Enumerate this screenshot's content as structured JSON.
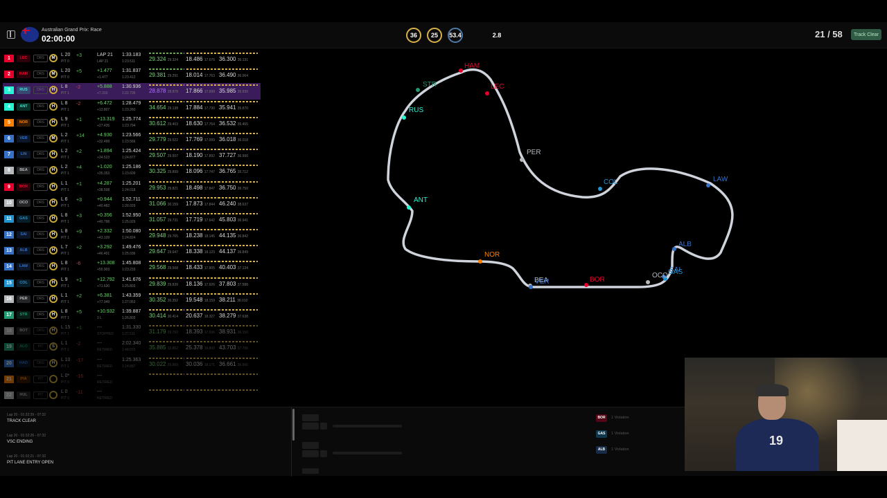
{
  "header": {
    "race_name": "Australian Grand Prix: Race",
    "clock": "02:00:00",
    "weather": [
      {
        "value": "36",
        "style": "yellow",
        "icon": "track-temp-icon"
      },
      {
        "value": "25",
        "style": "yellow",
        "icon": "air-temp-icon"
      },
      {
        "value": "53.4",
        "style": "blue",
        "icon": "humidity-icon"
      },
      {
        "value": "",
        "style": "plain",
        "icon": "rain-icon"
      },
      {
        "value": "2.8",
        "style": "plain",
        "icon": "wind-icon"
      }
    ],
    "lap_count": "21 / 58",
    "track_status": "Track Clear"
  },
  "timing": [
    {
      "pos": "1",
      "tag": "LEC",
      "color": "#e8002d",
      "drs": "DRS",
      "tyre": "M",
      "lap": "L 20",
      "pit": "PIT 0",
      "gain": "+3",
      "gain_color": "#5fbf5f",
      "gap": "LAP 21",
      "gap_sub": "LAP 21",
      "best": "1:33.183",
      "best_sub": "1:23.511",
      "s1": "29.324",
      "s1s": "29.324",
      "s2": "18.486",
      "s2s": "17.676",
      "s3": "36.300",
      "s3s": "36.131",
      "green": true
    },
    {
      "pos": "2",
      "tag": "HAM",
      "color": "#e8002d",
      "drs": "DRS",
      "tyre": "M",
      "lap": "L 20",
      "pit": "PIT 0",
      "gain": "+5",
      "gain_color": "#5fbf5f",
      "gap": "+1.477",
      "gap_sub": "+1.477",
      "best": "1:31.837",
      "best_sub": "1:23.412",
      "s1": "29.381",
      "s1s": "29.291",
      "s2": "18.014",
      "s2s": "17.763",
      "s3": "36.490",
      "s3s": "36.064",
      "green": true
    },
    {
      "pos": "3",
      "tag": "RUS",
      "color": "#27f4d2",
      "drs": "DRS",
      "tyre": "H",
      "lap": "L 8",
      "pit": "PIT 1",
      "gain": "-2",
      "gain_color": "#e04040",
      "gap": "+5.888",
      "gap_sub": "+7.310",
      "best": "1:30.936",
      "best_sub": "1:22.705",
      "s1": "28.878",
      "s1s": "28.878",
      "s2": "17.866",
      "s2s": "17.699",
      "s3": "35.985",
      "s3s": "35.930",
      "highlight": true
    },
    {
      "pos": "4",
      "tag": "ANT",
      "color": "#27f4d2",
      "drs": "DRS",
      "tyre": "H",
      "lap": "L 8",
      "pit": "PIT 1",
      "gain": "-2",
      "gain_color": "#e04040",
      "gap": "+6.472",
      "gap_sub": "+13.807",
      "best": "1:28.479",
      "best_sub": "1:23.260",
      "s1": "34.654",
      "s1s": "29.138",
      "s2": "17.884",
      "s2s": "17.730",
      "s3": "35.941",
      "s3s": "35.870"
    },
    {
      "pos": "5",
      "tag": "NOR",
      "color": "#ff8000",
      "drs": "DRS",
      "tyre": "H",
      "lap": "L 9",
      "pit": "PIT 1",
      "gain": "+1",
      "gain_color": "#5fbf5f",
      "gap": "+13.319",
      "gap_sub": "+27.435",
      "best": "1:25.774",
      "best_sub": "1:23.794",
      "s1": "30.612",
      "s1s": "29.403",
      "s2": "18.630",
      "s2s": "17.764",
      "s3": "36.532",
      "s3s": "35.465"
    },
    {
      "pos": "6",
      "tag": "VER",
      "color": "#3671c6",
      "drs": "DRS",
      "tyre": "M",
      "lap": "L 2",
      "pit": "PIT 1",
      "gain": "+14",
      "gain_color": "#5fbf5f",
      "gap": "+4.930",
      "gap_sub": "+32.499",
      "best": "1:23.566",
      "best_sub": "1:23.566",
      "s1": "29.779",
      "s1s": "29.522",
      "s2": "17.769",
      "s2s": "17.099",
      "s3": "36.018",
      "s3s": "36.018"
    },
    {
      "pos": "7",
      "tag": "LIN",
      "color": "#3671c6",
      "drs": "DRS",
      "tyre": "H",
      "lap": "L 2",
      "pit": "PIT 1",
      "gain": "+2",
      "gain_color": "#5fbf5f",
      "gap": "+1.894",
      "gap_sub": "+34.523",
      "best": "1:25.424",
      "best_sub": "1:24.877",
      "s1": "29.507",
      "s1s": "29.507",
      "s2": "18.190",
      "s2s": "17.892",
      "s3": "37.727",
      "s3s": "36.990"
    },
    {
      "pos": "8",
      "tag": "BEA",
      "color": "#b6babd",
      "drs": "DRS",
      "tyre": "H",
      "lap": "L 2",
      "pit": "PIT 1",
      "gain": "+4",
      "gain_color": "#5fbf5f",
      "gap": "+1.020",
      "gap_sub": "+35.353",
      "best": "1:25.186",
      "best_sub": "1:23.609",
      "s1": "30.325",
      "s1s": "29.899",
      "s2": "18.096",
      "s2s": "17.747",
      "s3": "36.765",
      "s3s": "35.712"
    },
    {
      "pos": "9",
      "tag": "BOR",
      "color": "#e8002d",
      "drs": "DRS",
      "tyre": "H",
      "lap": "L 1",
      "pit": "PIT 1",
      "gain": "+1",
      "gain_color": "#5fbf5f",
      "gap": "+4.287",
      "gap_sub": "+38.508",
      "best": "1:25.201",
      "best_sub": "1:24.018",
      "s1": "29.953",
      "s1s": "29.821",
      "s2": "18.498",
      "s2s": "17.847",
      "s3": "36.750",
      "s3s": "36.750"
    },
    {
      "pos": "10",
      "tag": "OCO",
      "color": "#b6babd",
      "drs": "DRS",
      "tyre": "H",
      "lap": "L 6",
      "pit": "PIT 1",
      "gain": "+3",
      "gain_color": "#5fbf5f",
      "gap": "+0.944",
      "gap_sub": "+40.482",
      "best": "1:52.711",
      "best_sub": "1:26.029",
      "s1": "31.066",
      "s1s": "30.159",
      "s2": "17.873",
      "s2s": "17.844",
      "s3": "46.240",
      "s3s": "38.637"
    },
    {
      "pos": "11",
      "tag": "GAS",
      "color": "#2293d1",
      "drs": "DRS",
      "tyre": "H",
      "lap": "L 8",
      "pit": "PIT 1",
      "gain": "+3",
      "gain_color": "#5fbf5f",
      "gap": "+0.356",
      "gap_sub": "+40.798",
      "best": "1:52.950",
      "best_sub": "1:25.029",
      "s1": "31.057",
      "s1s": "29.731",
      "s2": "17.719",
      "s2s": "17.642",
      "s3": "45.803",
      "s3s": "36.941"
    },
    {
      "pos": "12",
      "tag": "SAI",
      "color": "#3671c6",
      "drs": "DRS",
      "tyre": "H",
      "lap": "L 8",
      "pit": "PIT 1",
      "gain": "+9",
      "gain_color": "#5fbf5f",
      "gap": "+2.332",
      "gap_sub": "+43.109",
      "best": "1:50.080",
      "best_sub": "1:24.824",
      "s1": "29.948",
      "s1s": "29.765",
      "s2": "18.238",
      "s2s": "18.145",
      "s3": "44.135",
      "s3s": "36.842"
    },
    {
      "pos": "13",
      "tag": "ALB",
      "color": "#3671c6",
      "drs": "DRS",
      "tyre": "H",
      "lap": "L 7",
      "pit": "PIT 1",
      "gain": "+2",
      "gain_color": "#5fbf5f",
      "gap": "+3.292",
      "gap_sub": "+46.401",
      "best": "1:49.476",
      "best_sub": "1:25.036",
      "s1": "29.647",
      "s1s": "29.647",
      "s2": "18.338",
      "s2s": "18.123",
      "s3": "44.137",
      "s3s": "36.849"
    },
    {
      "pos": "14",
      "tag": "LAW",
      "color": "#3671c6",
      "drs": "DRS",
      "tyre": "H",
      "lap": "L 8",
      "pit": "PIT 1",
      "gain": "-6",
      "gain_color": "#e04040",
      "gap": "+13.308",
      "gap_sub": "+55.903",
      "best": "1:45.808",
      "best_sub": "1:23.233",
      "s1": "29.568",
      "s1s": "29.568",
      "s2": "18.433",
      "s2s": "17.905",
      "s3": "40.403",
      "s3s": "37.134"
    },
    {
      "pos": "15",
      "tag": "COL",
      "color": "#2293d1",
      "drs": "DRS",
      "tyre": "H",
      "lap": "L 9",
      "pit": "PIT 1",
      "gain": "+1",
      "gain_color": "#5fbf5f",
      "gap": "+12.792",
      "gap_sub": "+71.630",
      "best": "1:41.676",
      "best_sub": "1:25.803",
      "s1": "29.839",
      "s1s": "29.839",
      "s2": "18.136",
      "s2s": "17.926",
      "s3": "37.803",
      "s3s": "37.588"
    },
    {
      "pos": "16",
      "tag": "PER",
      "color": "#b6babd",
      "drs": "DRS",
      "tyre": "H",
      "lap": "L 1",
      "pit": "PIT 1",
      "gain": "+2",
      "gain_color": "#5fbf5f",
      "gap": "+6.381",
      "gap_sub": "+77.949",
      "best": "1:43.359",
      "best_sub": "1:27.053",
      "s1": "30.352",
      "s1s": "30.352",
      "s2": "19.548",
      "s2s": "18.159",
      "s3": "38.211",
      "s3s": "38.010"
    },
    {
      "pos": "17",
      "tag": "STR",
      "color": "#229971",
      "drs": "DRS",
      "tyre": "H",
      "lap": "L 8",
      "pit": "PIT 1",
      "gain": "+5",
      "gain_color": "#5fbf5f",
      "gap": "+10.932",
      "gap_sub": "1 L",
      "best": "1:39.887",
      "best_sub": "1:26.803",
      "s1": "30.414",
      "s1s": "30.414",
      "s2": "20.637",
      "s2s": "18.327",
      "s3": "38.279",
      "s3s": "37.638"
    },
    {
      "pos": "18",
      "tag": "BOT",
      "color": "#b6babd",
      "drs": "DRS",
      "tyre": "H",
      "lap": "L 15",
      "pit": "PIT 1",
      "gain": "+1",
      "gain_color": "#5fbf5f",
      "gap": "---",
      "gap_sub": "STOPPED",
      "best": "1:31.330",
      "best_sub": "1:27.511",
      "s1": "31.179",
      "s1s": "29.792",
      "s2": "18.393",
      "s2s": "17.936",
      "s3": "38.931",
      "s3s": "36.150",
      "faded": true
    },
    {
      "pos": "19",
      "tag": "ALO",
      "color": "#229971",
      "drs": "PIT",
      "tyre": "S",
      "lap": "L 1",
      "pit": "PIT 1",
      "gain": "-2",
      "gain_color": "#e04040",
      "gap": "---",
      "gap_sub": "RETIRED",
      "best": "2:02.340",
      "best_sub": "1:48.070",
      "s1": "35.885",
      "s1s": "32.852",
      "s2": "25.378",
      "s2s": "19.800",
      "s3": "43.703",
      "s3s": "37.706",
      "faded": true
    },
    {
      "pos": "20",
      "tag": "HAD",
      "color": "#3671c6",
      "drs": "DRS",
      "tyre": "H",
      "lap": "L 10",
      "pit": "PIT 1",
      "gain": "-17",
      "gain_color": "#e04040",
      "gap": "---",
      "gap_sub": "RETIRED",
      "best": "1:25.363",
      "best_sub": "1:24.887",
      "s1": "30.022",
      "s1s": "29.869",
      "s2": "30.036",
      "s2s": "18.171",
      "s3": "36.661",
      "s3s": "36.566",
      "faded": true
    },
    {
      "pos": "21",
      "tag": "PIA",
      "color": "#ff8000",
      "drs": "PIT",
      "tyre": "",
      "lap": "L 0*",
      "pit": "PIT 0",
      "gain": "-16",
      "gain_color": "#e04040",
      "gap": "---",
      "gap_sub": "RETIRED",
      "best": "",
      "best_sub": "",
      "s1": "",
      "s1s": "",
      "s2": "",
      "s2s": "",
      "s3": "",
      "s3s": "",
      "faded": true
    },
    {
      "pos": "22",
      "tag": "HUL",
      "color": "#b6babd",
      "drs": "PIT",
      "tyre": "",
      "lap": "L 0",
      "pit": "PIT 0",
      "gain": "-11",
      "gain_color": "#e04040",
      "gap": "---",
      "gap_sub": "RETIRED",
      "best": "",
      "best_sub": "",
      "s1": "",
      "s1s": "",
      "s2": "",
      "s2s": "",
      "s3": "",
      "s3s": "",
      "faded": true
    }
  ],
  "map": {
    "drivers": [
      {
        "code": "HAM",
        "color": "#e8002d"
      },
      {
        "code": "LEC",
        "color": "#e8002d"
      },
      {
        "code": "STR",
        "color": "#229971"
      },
      {
        "code": "RUS",
        "color": "#27f4d2"
      },
      {
        "code": "PER",
        "color": "#b6babd"
      },
      {
        "code": "COL",
        "color": "#2293d1"
      },
      {
        "code": "LAW",
        "color": "#3671c6"
      },
      {
        "code": "ANT",
        "color": "#27f4d2"
      },
      {
        "code": "NOR",
        "color": "#ff8000"
      },
      {
        "code": "ALB",
        "color": "#3671c6"
      },
      {
        "code": "SAI",
        "color": "#3671c6"
      },
      {
        "code": "GAS",
        "color": "#2293d1"
      },
      {
        "code": "OCO",
        "color": "#b6babd"
      },
      {
        "code": "BOR",
        "color": "#e8002d"
      },
      {
        "code": "BEA",
        "color": "#b6babd"
      },
      {
        "code": "VER",
        "color": "#3671c6"
      }
    ]
  },
  "race_control": [
    {
      "time": "Lap 20 - 01:32:39 - 07:32",
      "msg": "TRACK CLEAR"
    },
    {
      "time": "Lap 20 - 01:32:26 - 07:32",
      "msg": "VSC ENDING"
    },
    {
      "time": "Lap 20 - 01:32:21 - 07:32",
      "msg": "PIT LANE ENTRY OPEN"
    }
  ],
  "penalties": [
    {
      "tag": "BOR",
      "color": "#e8002d",
      "text": "1 Violation"
    },
    {
      "tag": "GAS",
      "color": "#2293d1",
      "text": "1 Violation"
    },
    {
      "tag": "ALB",
      "color": "#3671c6",
      "text": "1 Violation"
    }
  ]
}
